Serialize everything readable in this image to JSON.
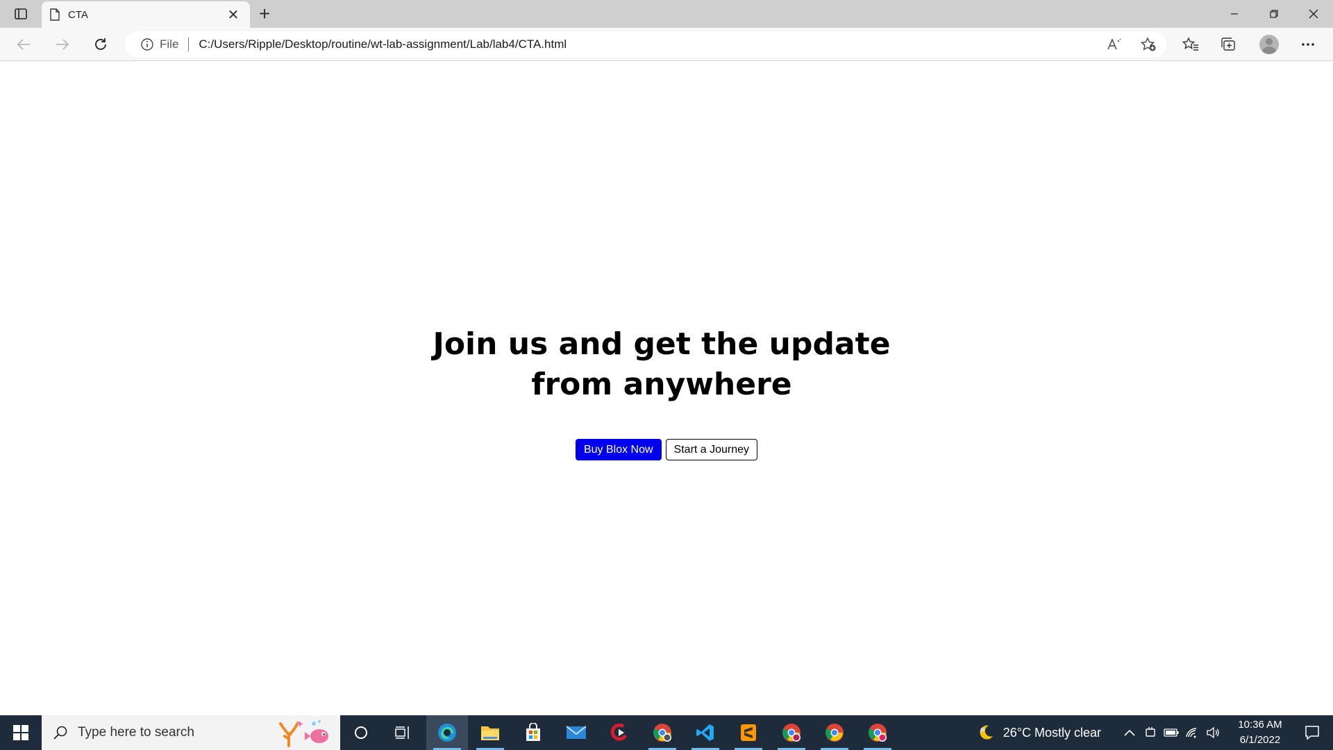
{
  "browser": {
    "tab_title": "CTA",
    "tab_close": "✕",
    "new_tab": "+",
    "address_scheme": "File",
    "address_url": "C:/Users/Ripple/Desktop/routine/wt-lab-assignment/Lab/lab4/CTA.html"
  },
  "page": {
    "heading": "Join us and get the update from anywhere",
    "primary_button": "Buy Blox Now",
    "secondary_button": "Start a Journey"
  },
  "taskbar": {
    "search_placeholder": "Type here to search",
    "weather": "26°C  Mostly clear",
    "time": "10:36 AM",
    "date": "6/1/2022"
  },
  "colors": {
    "primary_button_bg": "#0000ee",
    "taskbar_bg": "#1d2b3a",
    "tabbar_bg": "#cfcfcf"
  }
}
